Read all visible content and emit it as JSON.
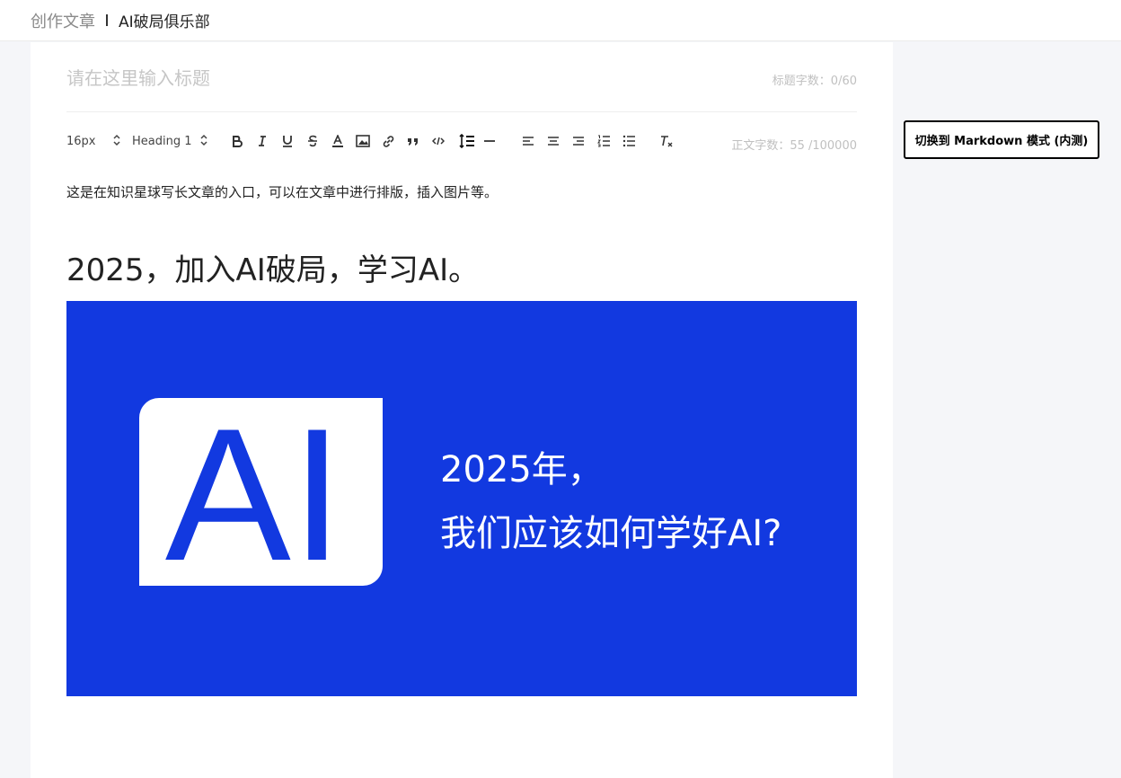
{
  "header": {
    "title": "创作文章",
    "group_name": "AI破局俱乐部"
  },
  "editor": {
    "title_placeholder": "请在这里输入标题",
    "title_value": "",
    "title_count": "标题字数：0/60",
    "body_count": "正文字数：55 /100000"
  },
  "toolbar": {
    "font_size": "16px",
    "heading": "Heading 1",
    "icons": [
      "bold-icon",
      "italic-icon",
      "underline-icon",
      "strikethrough-icon",
      "text-color-icon",
      "image-icon",
      "link-icon",
      "quote-icon",
      "code-icon",
      "line-height-icon",
      "divider-icon",
      "align-left-icon",
      "align-center-icon",
      "align-right-icon",
      "ordered-list-icon",
      "bullet-list-icon",
      "clear-format-icon"
    ]
  },
  "content": {
    "paragraph": "这是在知识星球写长文章的入口，可以在文章中进行排版，插入图片等。",
    "heading": "2025，加入AI破局，学习AI。",
    "banner": {
      "logo_text": "AI",
      "line1": "2025年，",
      "line2": "我们应该如何学好AI?",
      "background": "#1239e0"
    }
  },
  "sidebar": {
    "markdown_button": "切换到 Markdown 模式 (内测)"
  }
}
